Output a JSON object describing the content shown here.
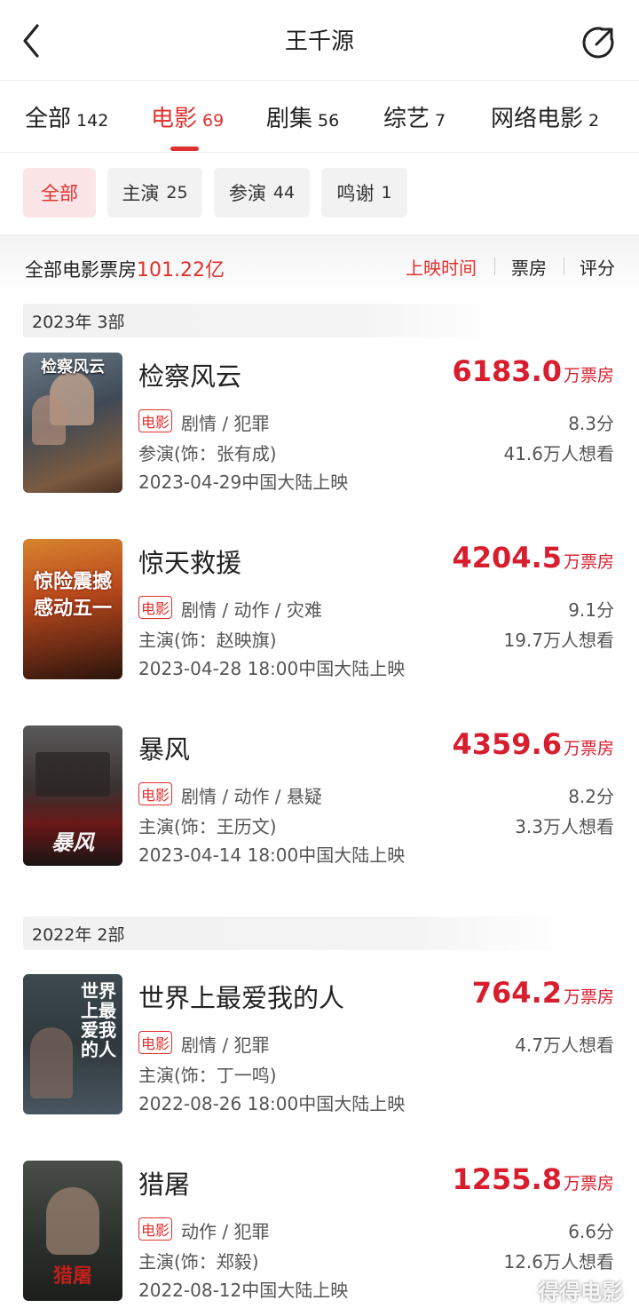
{
  "header": {
    "title": "王千源"
  },
  "tabs": [
    {
      "label": "全部",
      "count": "142"
    },
    {
      "label": "电影",
      "count": "69"
    },
    {
      "label": "剧集",
      "count": "56"
    },
    {
      "label": "综艺",
      "count": "7"
    },
    {
      "label": "网络电影",
      "count": "2"
    }
  ],
  "filters": [
    {
      "label": "全部",
      "count": ""
    },
    {
      "label": "主演",
      "count": "25"
    },
    {
      "label": "参演",
      "count": "44"
    },
    {
      "label": "鸣谢",
      "count": "1"
    }
  ],
  "summary": {
    "label": "全部电影票房",
    "value": "101.22亿"
  },
  "sort": [
    "上映时间",
    "票房",
    "评分"
  ],
  "years": [
    {
      "label": "2023年 3部"
    },
    {
      "label": "2022年 2部"
    }
  ],
  "films": [
    {
      "title": "检察风云",
      "box": "6183.0",
      "box_unit": "万票房",
      "badge": "电影",
      "genre": "剧情 / 犯罪",
      "score": "8.3分",
      "role": "参演(饰：张有成)",
      "wish": "41.6万人想看",
      "release": "2023-04-29中国大陆上映",
      "poster_text": "检察风云"
    },
    {
      "title": "惊天救援",
      "box": "4204.5",
      "box_unit": "万票房",
      "badge": "电影",
      "genre": "剧情 / 动作 / 灾难",
      "score": "9.1分",
      "role": "主演(饰：赵映旗)",
      "wish": "19.7万人想看",
      "release": "2023-04-28 18:00中国大陆上映",
      "poster_text": "惊险震撼 感动五一"
    },
    {
      "title": "暴风",
      "box": "4359.6",
      "box_unit": "万票房",
      "badge": "电影",
      "genre": "剧情 / 动作 / 悬疑",
      "score": "8.2分",
      "role": "主演(饰：王历文)",
      "wish": "3.3万人想看",
      "release": "2023-04-14 18:00中国大陆上映",
      "poster_text": "暴风"
    },
    {
      "title": "世界上最爱我的人",
      "box": "764.2",
      "box_unit": "万票房",
      "badge": "电影",
      "genre": "剧情 / 犯罪",
      "score": "",
      "role": "主演(饰：丁一鸣)",
      "wish": "4.7万人想看",
      "release": "2022-08-26 18:00中国大陆上映",
      "poster_text": "世界上最爱我的人"
    },
    {
      "title": "猎屠",
      "box": "1255.8",
      "box_unit": "万票房",
      "badge": "电影",
      "genre": "动作 / 犯罪",
      "score": "6.6分",
      "role": "主演(饰：郑毅)",
      "wish": "12.6万人想看",
      "release": "2022-08-12中国大陆上映",
      "poster_text": "猎屠"
    }
  ],
  "watermark": "得得电影",
  "colors": {
    "accent": "#e0302e",
    "box_office": "#d81e2e"
  }
}
